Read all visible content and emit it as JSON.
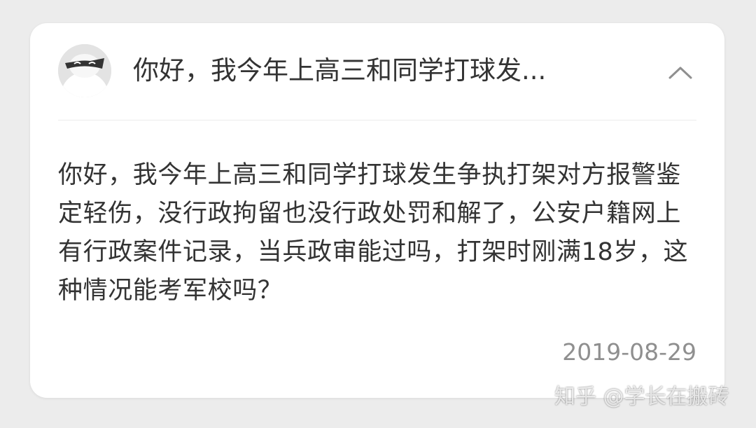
{
  "question": {
    "title": "你好，我今年上高三和同学打球发...",
    "content": "你好，我今年上高三和同学打球发生争执打架对方报警鉴定轻伤，没行政拘留也没行政处罚和解了，公安户籍网上有行政案件记录，当兵政审能过吗，打架时刚满18岁，这种情况能考军校吗？",
    "date": "2019-08-29"
  },
  "watermark": {
    "text": "知乎 @学长在搬砖"
  },
  "icons": {
    "avatar": "anonymous-avatar-icon",
    "collapse": "chevron-up-icon"
  },
  "colors": {
    "text": "#333333",
    "muted": "#8f8f8f",
    "divider": "#ebebeb",
    "background": "#ececec",
    "card": "#ffffff"
  }
}
